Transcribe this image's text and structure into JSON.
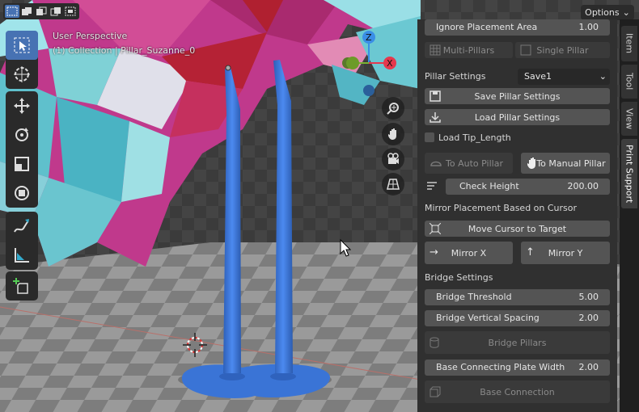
{
  "viewport": {
    "perspective_label": "User Perspective",
    "object_label": "(1) Collection | Pillar_Suzanne_0"
  },
  "header": {
    "options_label": "Options",
    "select_mode_icons": [
      "select-box-icon",
      "select-new-icon",
      "select-extend-icon",
      "select-subtract-icon",
      "select-intersect-icon"
    ]
  },
  "toolbar": {
    "tools": [
      "select-box-icon",
      "cursor-icon",
      "move-icon",
      "rotate-icon",
      "scale-icon",
      "transform-icon",
      "annotate-icon",
      "measure-icon",
      "add-cube-icon"
    ]
  },
  "gizmo": {
    "x": "X",
    "y": "Y",
    "z": "Z"
  },
  "panel": {
    "ignore_area": {
      "label": "Ignore Placement Area",
      "value": "1.00"
    },
    "multi_pillars": "Multi-Pillars",
    "single_pillar": "Single Pillar",
    "pillar_settings": {
      "label": "Pillar Settings",
      "selected": "Save1"
    },
    "save_settings": "Save Pillar Settings",
    "load_settings": "Load Pillar Settings",
    "load_tip": "Load Tip_Length",
    "to_auto": "To Auto Pillar",
    "to_manual": "To Manual Pillar",
    "check_height": {
      "label": "Check Height",
      "value": "200.00"
    },
    "mirror_header": "Mirror Placement Based on Cursor",
    "move_cursor": "Move Cursor to Target",
    "mirror_x": "Mirror X",
    "mirror_y": "Mirror Y",
    "bridge_header": "Bridge Settings",
    "bridge_threshold": {
      "label": "Bridge Threshold",
      "value": "5.00"
    },
    "bridge_spacing": {
      "label": "Bridge Vertical Spacing",
      "value": "2.00"
    },
    "bridge_pillars": "Bridge Pillars",
    "plate_width": {
      "label": "Base Connecting Plate Width",
      "value": "2.00"
    },
    "base_connection": "Base Connection"
  },
  "tabs": [
    "Item",
    "Tool",
    "View",
    "Print Support"
  ],
  "colors": {
    "accent": "#4772b3",
    "pillar": "#3d79d9"
  }
}
